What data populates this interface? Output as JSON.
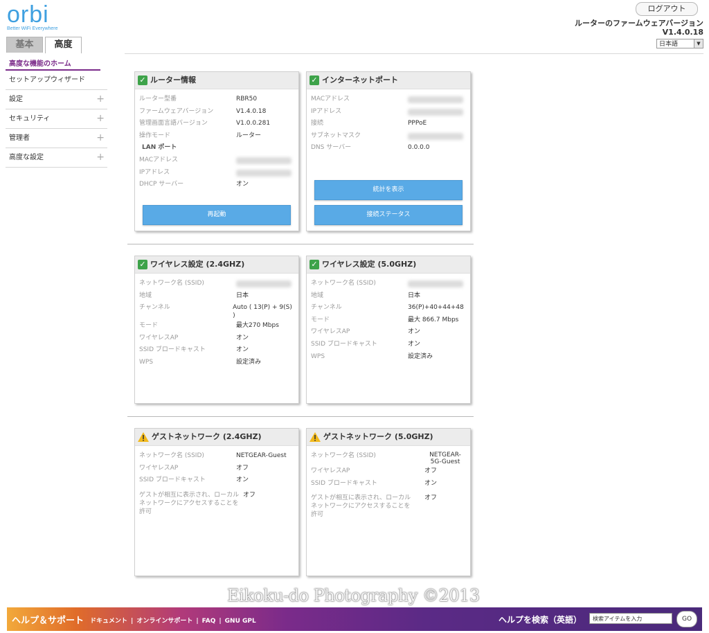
{
  "logo": {
    "word": "orbi",
    "tagline": "Better WiFi Everywhere"
  },
  "tabs": [
    {
      "label": "基本",
      "active": false
    },
    {
      "label": "高度",
      "active": true
    }
  ],
  "header": {
    "logout_label": "ログアウト",
    "firmware_title": "ルーターのファームウェアバージョン",
    "firmware_version": "V1.4.0.18",
    "language": "日本語"
  },
  "sidebar": {
    "items": [
      {
        "label": "高度な機能のホーム",
        "active": true,
        "expandable": false
      },
      {
        "label": "セットアップウィザード",
        "active": false,
        "expandable": false
      },
      {
        "label": "設定",
        "active": false,
        "expandable": true
      },
      {
        "label": "セキュリティ",
        "active": false,
        "expandable": true
      },
      {
        "label": "管理者",
        "active": false,
        "expandable": true
      },
      {
        "label": "高度な設定",
        "active": false,
        "expandable": true
      }
    ],
    "plus_glyph": "+"
  },
  "panels": {
    "router_info": {
      "title": "ルーター情報",
      "status": "ok",
      "rows": [
        {
          "k": "ルーター型番",
          "v": "RBR50"
        },
        {
          "k": "ファームウェアバージョン",
          "v": "V1.4.0.18"
        },
        {
          "k": "管理画面言語バージョン",
          "v": "V1.0.0.281"
        },
        {
          "k": "操作モード",
          "v": "ルーター"
        },
        {
          "k": "LAN ポート",
          "v": ""
        },
        {
          "k": "MACアドレス",
          "v": ""
        },
        {
          "k": "IPアドレス",
          "v": ""
        },
        {
          "k": "DHCP サーバー",
          "v": "オン"
        }
      ],
      "button": "再起動"
    },
    "internet_port": {
      "title": "インターネットポート",
      "status": "ok",
      "rows": [
        {
          "k": "MACアドレス",
          "v": ""
        },
        {
          "k": "IPアドレス",
          "v": ""
        },
        {
          "k": "接続",
          "v": "PPPoE"
        },
        {
          "k": "サブネットマスク",
          "v": ""
        },
        {
          "k": "DNS サーバー",
          "v": "0.0.0.0"
        }
      ],
      "button_stats": "統計を表示",
      "button_status": "接続ステータス"
    },
    "wireless_24": {
      "title": "ワイヤレス設定 (2.4GHZ)",
      "status": "ok",
      "rows": [
        {
          "k": "ネットワーク名 (SSID)",
          "v": ""
        },
        {
          "k": "地域",
          "v": "日本"
        },
        {
          "k": "チャンネル",
          "v": "Auto ( 13(P) + 9(S) )"
        },
        {
          "k": "モード",
          "v": "最大270 Mbps"
        },
        {
          "k": "ワイヤレスAP",
          "v": "オン"
        },
        {
          "k": "SSID ブロードキャスト",
          "v": "オン"
        },
        {
          "k": "WPS",
          "v": "設定済み"
        }
      ]
    },
    "wireless_50": {
      "title": "ワイヤレス設定 (5.0GHZ)",
      "status": "ok",
      "rows": [
        {
          "k": "ネットワーク名 (SSID)",
          "v": ""
        },
        {
          "k": "地域",
          "v": "日本"
        },
        {
          "k": "チャンネル",
          "v": "36(P)+40+44+48"
        },
        {
          "k": "モード",
          "v": "最大 866.7 Mbps"
        },
        {
          "k": "ワイヤレスAP",
          "v": "オン"
        },
        {
          "k": "SSID ブロードキャスト",
          "v": "オン"
        },
        {
          "k": "WPS",
          "v": "設定済み"
        }
      ]
    },
    "guest_24": {
      "title": "ゲストネットワーク (2.4GHZ)",
      "status": "warning",
      "rows": [
        {
          "k": "ネットワーク名 (SSID)",
          "v": "NETGEAR-Guest"
        },
        {
          "k": "ワイヤレスAP",
          "v": "オフ"
        },
        {
          "k": "SSID ブロードキャスト",
          "v": "オン"
        },
        {
          "k": "ゲストが相互に表示され、ローカルネットワークにアクセスすることを許可",
          "v": "オフ"
        }
      ]
    },
    "guest_50": {
      "title": "ゲストネットワーク (5.0GHZ)",
      "status": "warning",
      "rows": [
        {
          "k": "ネットワーク名 (SSID)",
          "v": "NETGEAR-5G-Guest"
        },
        {
          "k": "ワイヤレスAP",
          "v": "オフ"
        },
        {
          "k": "SSID ブロードキャスト",
          "v": "オン"
        },
        {
          "k": "ゲストが相互に表示され、ローカルネットワークにアクセスすることを許可",
          "v": "オフ"
        }
      ]
    }
  },
  "footer": {
    "help": "ヘルプ＆サポート",
    "links": [
      "ドキュメント",
      "オンラインサポート",
      "FAQ",
      "GNU GPL"
    ],
    "separator": "|",
    "search_label": "ヘルプを検索（英語）",
    "search_placeholder": "検索アイテムを入力",
    "go_label": "GO"
  },
  "watermark": "Eikoku-do Photography ©2013",
  "colors": {
    "accent": "#7b2b8a",
    "button": "#59aae6",
    "logo": "#3fa0e0",
    "ok": "#3ea34a",
    "warning": "#f2b91b"
  }
}
